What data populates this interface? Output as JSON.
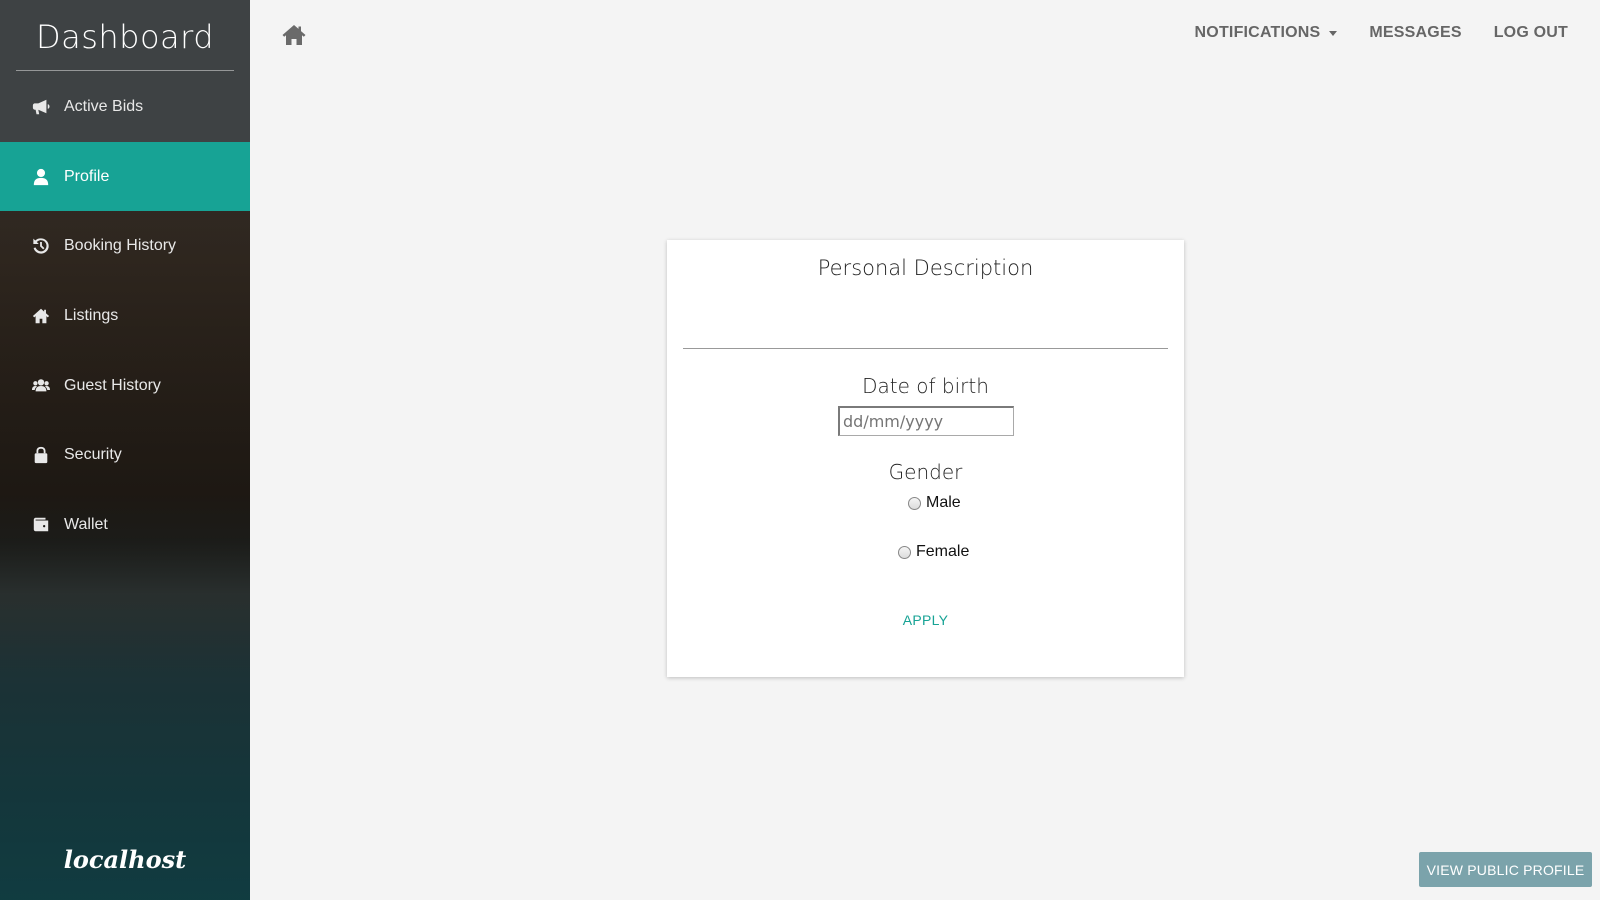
{
  "sidebar": {
    "title": "Dashboard",
    "brand": "localhost",
    "items": [
      {
        "label": "Active Bids",
        "icon": "megaphone-icon"
      },
      {
        "label": "Profile",
        "icon": "user-icon",
        "active": true
      },
      {
        "label": "Booking History",
        "icon": "history-icon"
      },
      {
        "label": "Listings",
        "icon": "home-icon"
      },
      {
        "label": "Guest History",
        "icon": "users-icon"
      },
      {
        "label": "Security",
        "icon": "lock-icon"
      },
      {
        "label": "Wallet",
        "icon": "wallet-icon"
      }
    ],
    "accent_color": "#17a395"
  },
  "topnav": {
    "home_icon": "home-icon",
    "notifications": "NOTIFICATIONS",
    "messages": "MESSAGES",
    "logout": "LOG OUT"
  },
  "card": {
    "title": "Personal Description",
    "dob_label": "Date of birth",
    "dob_placeholder": "dd/mm/yyyy",
    "gender_label": "Gender",
    "gender_options": [
      "Male",
      "Female"
    ],
    "apply": "APPLY"
  },
  "public_profile_button": "VIEW PUBLIC PROFILE"
}
